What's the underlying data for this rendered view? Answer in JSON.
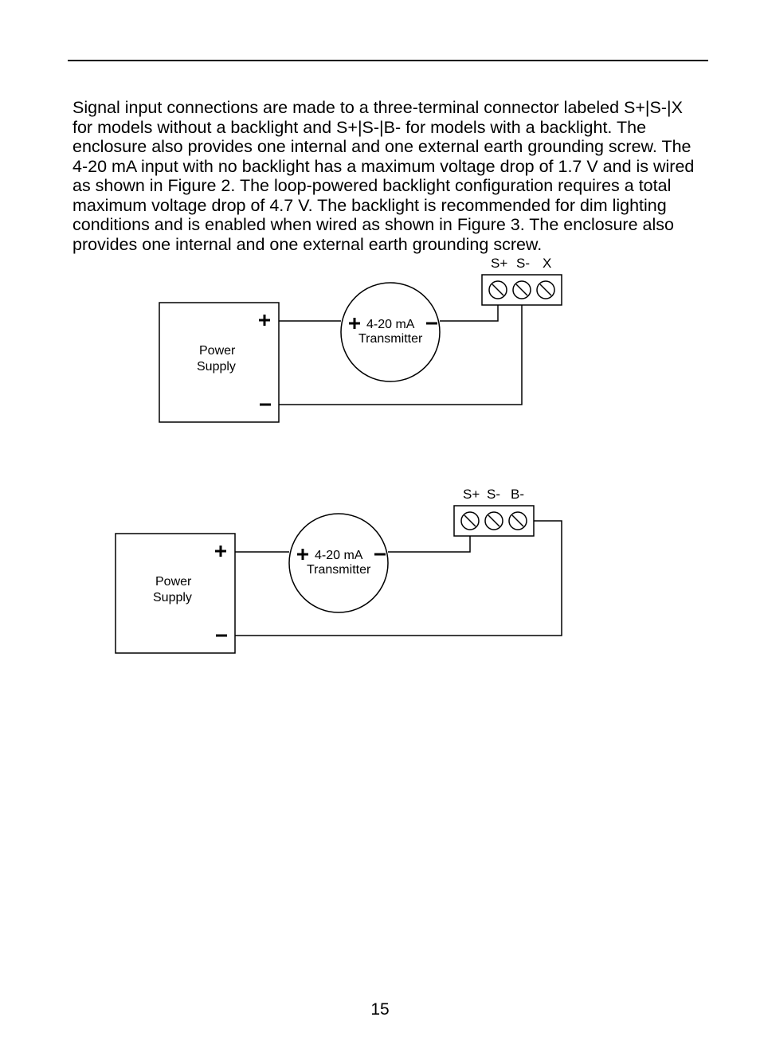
{
  "page_number": "15",
  "paragraph": "Signal input connections are made to a three-terminal connector labeled S+|S-|X for models without a backlight and S+|S-|B- for models with a backlight. The enclosure also provides one internal and one external earth grounding screw. The 4-20 mA input with no backlight has a maximum voltage drop of 1.7 V and is wired as shown in Figure 2. The loop-powered backlight configuration requires a total maximum voltage drop of 4.7 V. The backlight is recommended for dim lighting conditions and is enabled when wired as shown in Figure 3. The enclosure also provides one internal and one external earth grounding screw.",
  "diagram1": {
    "power_label_1": "Power",
    "power_label_2": "Supply",
    "tx_label_1": "4-20 mA",
    "tx_label_2": "Transmitter",
    "t1": "S+",
    "t2": "S-",
    "t3": "X"
  },
  "diagram2": {
    "power_label_1": "Power",
    "power_label_2": "Supply",
    "tx_label_1": "4-20 mA",
    "tx_label_2": "Transmitter",
    "t1": "S+",
    "t2": "S-",
    "t3": "B-"
  }
}
